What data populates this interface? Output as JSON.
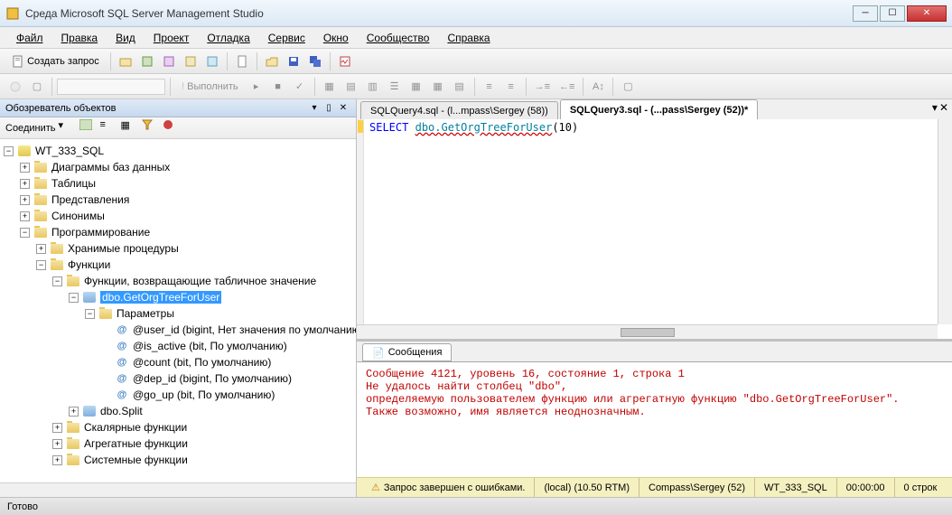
{
  "window": {
    "title": "Среда Microsoft SQL Server Management Studio"
  },
  "menubar": {
    "items": [
      "Файл",
      "Правка",
      "Вид",
      "Проект",
      "Отладка",
      "Сервис",
      "Окно",
      "Сообщество",
      "Справка"
    ]
  },
  "toolbar1": {
    "new_query": "Создать запрос"
  },
  "toolbar2": {
    "execute": "Выполнить"
  },
  "sidebar": {
    "title": "Обозреватель объектов",
    "connect": "Соединить",
    "tree": {
      "db": "WT_333_SQL",
      "n_diagrams": "Диаграммы баз данных",
      "n_tables": "Таблицы",
      "n_views": "Представления",
      "n_synonyms": "Синонимы",
      "n_prog": "Программирование",
      "n_sproc": "Хранимые процедуры",
      "n_func": "Функции",
      "n_tvf": "Функции, возвращающие табличное значение",
      "n_selected": "dbo.GetOrgTreeForUser",
      "n_params": "Параметры",
      "p_user_id": "@user_id (bigint, Нет значения по умолчанию)",
      "p_is_active": "@is_active (bit, По умолчанию)",
      "p_count": "@count (bit, По умолчанию)",
      "p_dep_id": "@dep_id (bigint, По умолчанию)",
      "p_go_up": "@go_up (bit, По умолчанию)",
      "n_split": "dbo.Split",
      "n_scalar": "Скалярные функции",
      "n_agg": "Агрегатные функции",
      "n_sys": "Системные функции"
    }
  },
  "tabs": {
    "t1": "SQLQuery4.sql - (l...mpass\\Sergey (58))",
    "t2": "SQLQuery3.sql - (...pass\\Sergey (52))*"
  },
  "editor": {
    "code": {
      "kw": "SELECT",
      "fn": "dbo.GetOrgTreeForUser",
      "arg": "(10)"
    }
  },
  "results": {
    "tab_messages": "Сообщения",
    "msg_l1": "Сообщение 4121, уровень 16, состояние 1, строка 1",
    "msg_l2": "Не удалось найти столбец \"dbo\",",
    "msg_l3": "определяемую пользователем функцию или агрегатную функцию \"dbo.GetOrgTreeForUser\".",
    "msg_l4": "Также возможно, имя является неоднозначным.",
    "status": {
      "text": "Запрос завершен с ошибками.",
      "server": "(local) (10.50 RTM)",
      "user": "Compass\\Sergey (52)",
      "db": "WT_333_SQL",
      "time": "00:00:00",
      "rows": "0 строк"
    }
  },
  "statusbar": {
    "text": "Готово"
  }
}
